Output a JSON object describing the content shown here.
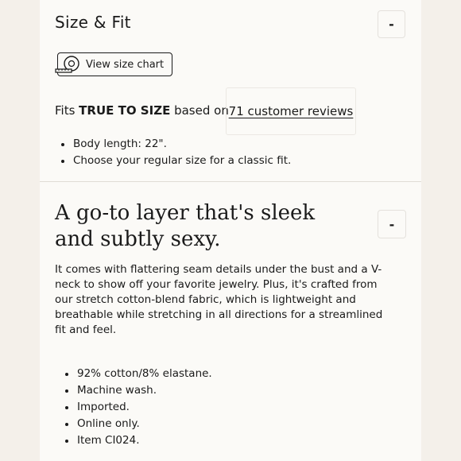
{
  "size_fit": {
    "title": "Size & Fit",
    "toggle_symbol": "-",
    "size_chart_button": {
      "label": "View size chart",
      "icon": "measuring-tape-icon"
    },
    "fits_prefix": "Fits ",
    "fits_emphasis": "TRUE TO SIZE",
    "fits_suffix": " based on",
    "reviews_link": "71 customer reviews",
    "bullets": [
      "Body length: 22\".",
      "Choose your regular size for a classic fit."
    ]
  },
  "description": {
    "title": "A go-to layer that's sleek and subtly sexy.",
    "toggle_symbol": "-",
    "body": "It comes with flattering seam details under the bust and a V-neck to show off your favorite jewelry. Plus, it's crafted from our stretch cotton-blend fabric, which is lightweight and breathable while stretching in all directions for a streamlined fit and feel.",
    "details": [
      "92% cotton/8% elastane.",
      "Machine wash.",
      "Imported.",
      "Online only.",
      "Item CI024."
    ]
  }
}
